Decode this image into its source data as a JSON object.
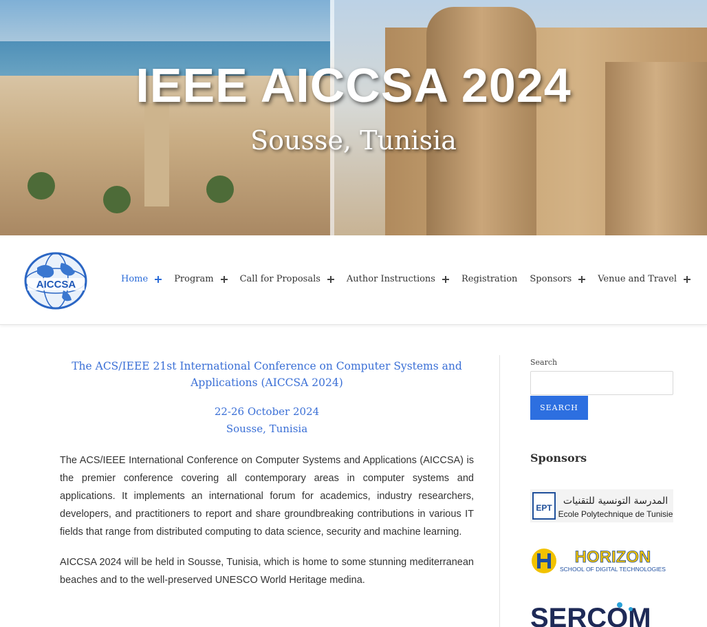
{
  "hero": {
    "title": "IEEE AICCSA 2024",
    "subtitle": "Sousse, Tunisia"
  },
  "logo": {
    "text": "AICCSA"
  },
  "nav": {
    "items": [
      {
        "label": "Home",
        "has_submenu": true,
        "active": true
      },
      {
        "label": "Program",
        "has_submenu": true
      },
      {
        "label": "Call for Proposals",
        "has_submenu": true
      },
      {
        "label": "Author Instructions",
        "has_submenu": true
      },
      {
        "label": "Registration",
        "has_submenu": false
      },
      {
        "label": "Sponsors",
        "has_submenu": true
      },
      {
        "label": "Venue and Travel",
        "has_submenu": true
      }
    ]
  },
  "main": {
    "conf_title": "The ACS/IEEE 21st International Conference on Computer Systems and Applications (AICCSA 2024)",
    "date": "22-26 October 2024",
    "location": "Sousse, Tunisia",
    "paragraphs": [
      "The ACS/IEEE International Conference on Computer Systems and Applications (AICCSA) is the premier conference covering all contemporary areas in computer systems and applications. It implements an international forum for academics, industry researchers, developers, and practitioners to report and share groundbreaking contributions in various IT fields that range from distributed computing to data science, security and machine learning.",
      "AICCSA 2024 will be held in Sousse, Tunisia, which is home to some stunning mediterranean beaches and to the well-preserved UNESCO World Heritage medina."
    ]
  },
  "sidebar": {
    "search_label": "Search",
    "search_value": "",
    "search_button": "SEARCH",
    "sponsors_heading": "Sponsors",
    "sponsors": [
      {
        "name_ar": "المدرسة التونسية للتقنيات",
        "name": "Ecole Polytechnique de Tunisie",
        "mark": "EPT"
      },
      {
        "name": "HORIZON",
        "tagline": "SCHOOL OF DIGITAL TECHNOLOGIES"
      },
      {
        "name": "SERCOM"
      }
    ]
  },
  "colors": {
    "accent": "#2d6fe0",
    "link": "#3a6fd6",
    "text": "#333333",
    "horizon_yellow": "#f2c200",
    "horizon_blue": "#1f4fa0"
  }
}
